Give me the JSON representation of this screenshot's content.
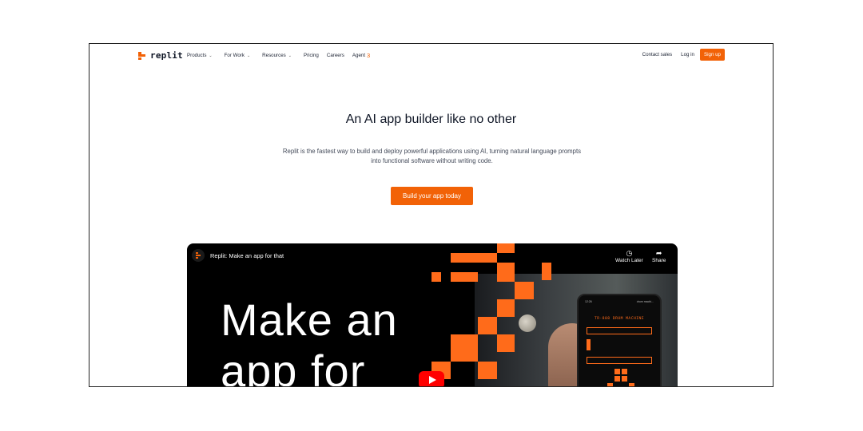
{
  "nav": {
    "brand": "replit",
    "links": [
      {
        "label": "Products",
        "dropdown": true
      },
      {
        "label": "For Work",
        "dropdown": true
      },
      {
        "label": "Resources",
        "dropdown": true
      },
      {
        "label": "Pricing",
        "dropdown": false
      },
      {
        "label": "Careers",
        "dropdown": false
      },
      {
        "label": "Agent",
        "dropdown": false
      }
    ],
    "agent_badge": "3",
    "contact_sales": "Contact sales",
    "login": "Log in",
    "signup": "Sign up"
  },
  "hero": {
    "title": "An AI app builder like no other",
    "description": "Replit is the fastest way to build and deploy powerful applications using AI, turning natural language prompts into functional software without writing code.",
    "cta": "Build your app today"
  },
  "video": {
    "title": "Replit: Make an app for that",
    "watch_later": "Watch Later",
    "share": "Share",
    "overlay_line1": "Make an",
    "overlay_line2": "app for",
    "phone": {
      "app_title": "TR-808 DRUM MACHINE",
      "status_time": "12:26",
      "url": "drum machi..."
    }
  },
  "colors": {
    "accent": "#f26207",
    "text_dark": "#0e1525",
    "video_orange": "#ff6b1a",
    "youtube_red": "#ff0000"
  },
  "icons": [
    "replit-logo-icon",
    "chevron-down-icon",
    "clock-icon",
    "share-icon",
    "youtube-play-icon"
  ]
}
